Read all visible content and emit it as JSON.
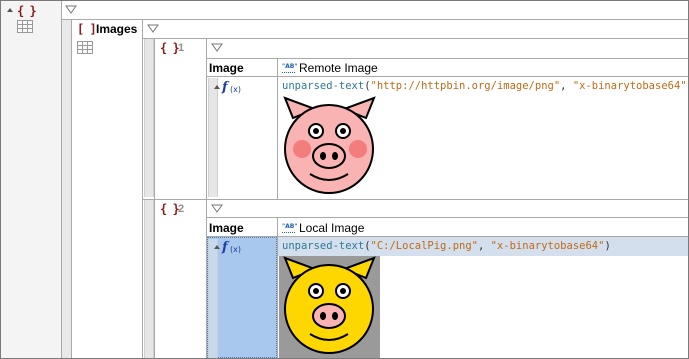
{
  "root": {
    "brace": "{ }"
  },
  "images": {
    "brace": "[ ]",
    "label": "Images"
  },
  "rows": [
    {
      "brace": "{ }",
      "index": "1",
      "col_header": "Image",
      "title": "Remote Image",
      "fn": "unparsed-text",
      "arg1": "\"http://httpbin.org/image/png\"",
      "arg2": "\"x-binarytobase64\"",
      "image": "pink-pig"
    },
    {
      "brace": "{ }",
      "index": "2",
      "col_header": "Image",
      "title": "Local Image",
      "fn": "unparsed-text",
      "arg1": "\"C:/LocalPig.png\"",
      "arg2": "\"x-binarytobase64\"",
      "image": "yellow-pig"
    }
  ],
  "ab_tag": "\"AB\"",
  "fx_label": "f",
  "fx_sub": "(x)",
  "colors": {
    "selection": "#a9c8ee",
    "selected_row": "#d3dfec",
    "pink_pig": "#f9b3b3",
    "yellow_pig": "#ffd700"
  }
}
